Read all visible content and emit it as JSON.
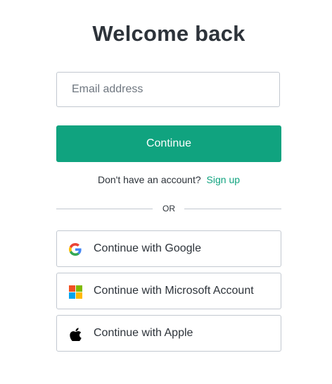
{
  "page": {
    "title": "Welcome back"
  },
  "email": {
    "placeholder": "Email address",
    "value": ""
  },
  "continue_label": "Continue",
  "signup": {
    "prompt": "Don't have an account?",
    "link_label": "Sign up"
  },
  "divider_label": "OR",
  "social": {
    "google_label": "Continue with Google",
    "microsoft_label": "Continue with Microsoft Account",
    "apple_label": "Continue with Apple"
  },
  "colors": {
    "accent": "#10a37f",
    "text": "#2d333a",
    "border": "#c2c8d0"
  },
  "icons": {
    "google": "google-icon",
    "microsoft": "microsoft-icon",
    "apple": "apple-icon"
  }
}
